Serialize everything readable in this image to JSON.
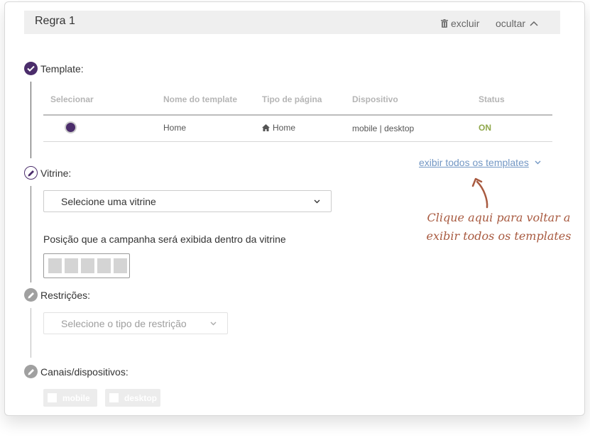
{
  "rule": {
    "title": "Regra 1",
    "delete_label": "excluir",
    "hide_label": "ocultar"
  },
  "steps": {
    "template": "Template:",
    "vitrine": "Vitrine:",
    "restricoes": "Restrições:",
    "canais": "Canais/dispositivos:"
  },
  "table": {
    "headers": [
      "Selecionar",
      "Nome do template",
      "Tipo de página",
      "Dispositivo",
      "Status"
    ],
    "rows": [
      {
        "name": "Home",
        "page_type": "Home",
        "device": "mobile | desktop",
        "status": "ON"
      }
    ]
  },
  "show_all_link": "exibir todos os templates",
  "vitrine_select": {
    "value": "Selecione uma vitrine"
  },
  "position": {
    "label": "Posição que a campanha será exibida dentro da vitrine",
    "slots": 5
  },
  "restriction_select": {
    "placeholder": "Selecione o tipo de restrição"
  },
  "channels": [
    "mobile",
    "desktop"
  ],
  "annotation": {
    "line1": "Clique aqui para voltar a",
    "line2": "exibir todos os templates"
  },
  "colors": {
    "primary": "#4b2d6b",
    "status_on": "#8fa74a",
    "link": "#7397c4",
    "annotation": "#a85a40",
    "disabled": "#9e9e9e"
  }
}
